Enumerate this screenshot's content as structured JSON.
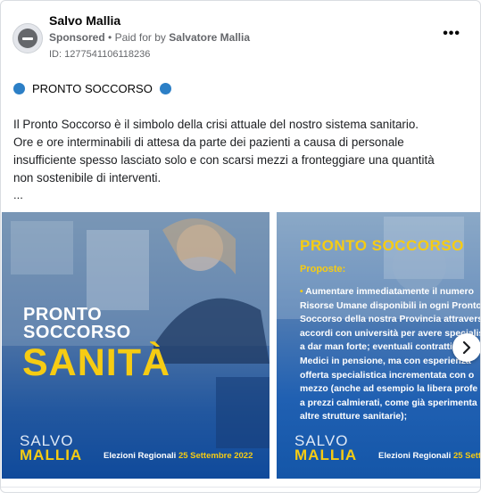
{
  "page": {
    "name": "Salvo Mallia"
  },
  "sponsor": {
    "label": "Sponsored",
    "paid_prefix": "Paid for by",
    "payer": "Salvatore Mallia"
  },
  "ad": {
    "id_text": "ID: 1277541106118236"
  },
  "menu": {
    "icon": "more-horizontal-icon"
  },
  "headline": "PRONTO SOCCORSO",
  "body_lines": [
    "Il Pronto Soccorso è il simbolo della crisi attuale del nostro sistema sanitario.",
    "Ore e ore interminabili di attesa da parte dei pazienti a causa di personale",
    "insufficiente spesso lasciato solo e con scarsi mezzi a fronteggiare una quantità",
    "non sostenibile di interventi."
  ],
  "ellipsis": "...",
  "carousel": {
    "slide1": {
      "title_top": "PRONTO",
      "title_mid": "SOCCORSO",
      "title_big": "SANITÀ",
      "brand_first": "SALVO",
      "brand_last": "MALLIA",
      "footer_prefix": "Elezioni Regionali",
      "footer_date": "25 Settembre 2022"
    },
    "slide2": {
      "title": "PRONTO SOCCORSO",
      "label": "Proposte:",
      "lines": [
        "Aumentare immediatamente il numero",
        "Risorse Umane disponibili in ogni Pronto",
        "Soccorso della nostra Provincia attraverso",
        "accordi con università per avere specialisti",
        "a dar man forte; eventuali contratti",
        "Medici in pensione, ma con esperienza",
        "offerta specialistica incrementata con o",
        "mezzo (anche ad esempio la libera profe",
        "a prezzi calmierati, come già sperimenta",
        "altre strutture sanitarie);"
      ],
      "brand_first": "SALVO",
      "brand_last": "MALLIA",
      "footer_prefix": "Elezioni Regionali",
      "footer_date": "25 Settembre 2022"
    },
    "next_icon": "chevron-right-icon"
  },
  "colors": {
    "accent_blue": "#2c7fc6",
    "brand_yellow": "#f6cc13",
    "slide_blue": "#0f4a9b"
  }
}
